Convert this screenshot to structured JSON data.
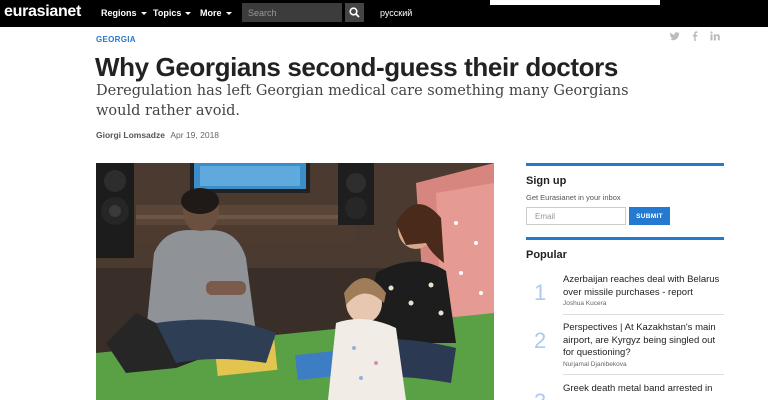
{
  "nav": {
    "logo": "eurasianet",
    "items": [
      {
        "label": "Regions"
      },
      {
        "label": "Topics"
      },
      {
        "label": "More"
      }
    ],
    "search_placeholder": "Search",
    "language": "русский"
  },
  "article": {
    "kicker": "GEORGIA",
    "headline": "Why Georgians second-guess their doctors",
    "deck": "Deregulation has left Georgian medical care something many Georgians would rather avoid.",
    "author": "Giorgi Lomsadze",
    "date": "Apr 19, 2018"
  },
  "share": {
    "icons": [
      "twitter-icon",
      "facebook-icon",
      "linkedin-icon"
    ]
  },
  "sidebar": {
    "signup_title": "Sign up",
    "signup_sub": "Get Eurasianet in your inbox",
    "email_placeholder": "Email",
    "submit_label": "SUBMIT",
    "popular_title": "Popular",
    "popular": [
      {
        "num": "1",
        "title": "Azerbaijan reaches deal with Belarus over missile purchases - report",
        "author": "Joshua Kucera"
      },
      {
        "num": "2",
        "title": "Perspectives | At Kazakhstan's main airport, are Kyrgyz being singled out for questioning?",
        "author": "Nurjamal Djanibekova"
      },
      {
        "num": "3",
        "title": "Greek death metal band arrested in",
        "author": ""
      }
    ]
  },
  "colors": {
    "accent": "#2479d1",
    "topbar": "#000000",
    "popular_number": "#a9cbee"
  }
}
